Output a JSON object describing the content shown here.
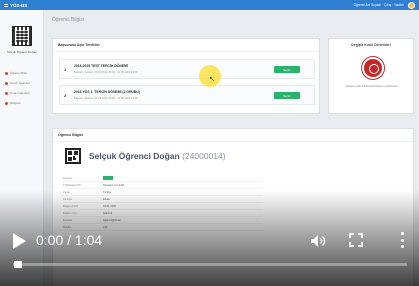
{
  "topbar": {
    "brand": "YÖS-BS",
    "right_text": "Öğrenci Adı Soyadı · Çıkış · Yardım"
  },
  "sidebar": {
    "user": "Selçuk Öğrenci Doğan",
    "items": [
      {
        "label": "Öğrenci Bilgi"
      },
      {
        "label": "Tercih İşlemleri"
      },
      {
        "label": "Sınav İşlemleri"
      },
      {
        "label": "Belgeler"
      }
    ]
  },
  "page_title": "Öğrenci Bilgisi",
  "preferences": {
    "title": "Başvurusu Açık Tercihler",
    "items": [
      {
        "num": "1",
        "title": "2016-2025 TEST TERCİH DÖNEMİ",
        "subtitle": "Başvuru Tarihleri: 20.06.2016 09:00 - 31.08.2016 23:59",
        "button": "Seçim"
      },
      {
        "num": "2",
        "title": "2016 YÖS 1. TERCİH DÖNEMİ (2.GRUBU)",
        "subtitle": "Başvuru Tarihleri: 20.06.2016 09:00 - 31.08.2016 23:59",
        "button": "Seçim"
      }
    ]
  },
  "seal": {
    "title": "Değişik Kurul Dönemleri",
    "note": "Belirtilen tarih aralıklarında başvuru yapabilirsiniz"
  },
  "student": {
    "section_title": "Öğrenci Bilgisi",
    "name": "Selçuk Öğrenci Doğan",
    "id": "(24000014)",
    "rows": [
      {
        "key": "Durumu",
        "value": ""
      },
      {
        "key": "TC/Pasaport No",
        "value": "Pasaport ve kimlik"
      },
      {
        "key": "Uyruk",
        "value": "Türkiye"
      },
      {
        "key": "Cinsiyet",
        "value": "Erkek"
      },
      {
        "key": "Doğum Tarihi",
        "value": "01.01.1995"
      },
      {
        "key": "Doğum Yeri",
        "value": "İstanbul"
      },
      {
        "key": "E-posta",
        "value": "öğrenci@örnek"
      },
      {
        "key": "Telefon",
        "value": "+90"
      }
    ]
  },
  "video": {
    "time": "0:00 / 1:04",
    "progress": 0
  }
}
